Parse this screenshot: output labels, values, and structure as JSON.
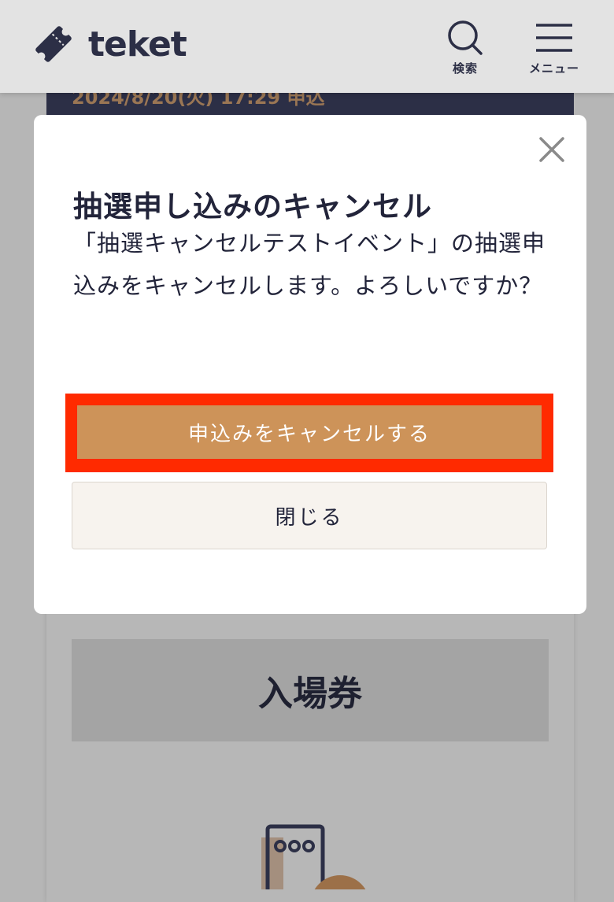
{
  "header": {
    "logo_text": "teket",
    "search_label": "検索",
    "menu_label": "メニュー"
  },
  "background": {
    "date_band_text": "2024/8/20(火) 17:29 申込",
    "ticket_type_label": "入場券"
  },
  "modal": {
    "title": "抽選申し込みのキャンセル",
    "body": "「抽選キャンセルテストイベント」の抽選申込みをキャンセルします。よろしいですか？",
    "confirm_button": "申込みをキャンセルする",
    "close_button": "閉じる"
  },
  "colors": {
    "brand_dark": "#2c2f46",
    "accent": "#cd9359",
    "highlight": "#ff2a00"
  },
  "icons": [
    "ticket-logo-icon",
    "search-icon",
    "hamburger-menu-icon",
    "close-icon",
    "ticket-illustration-icon"
  ]
}
